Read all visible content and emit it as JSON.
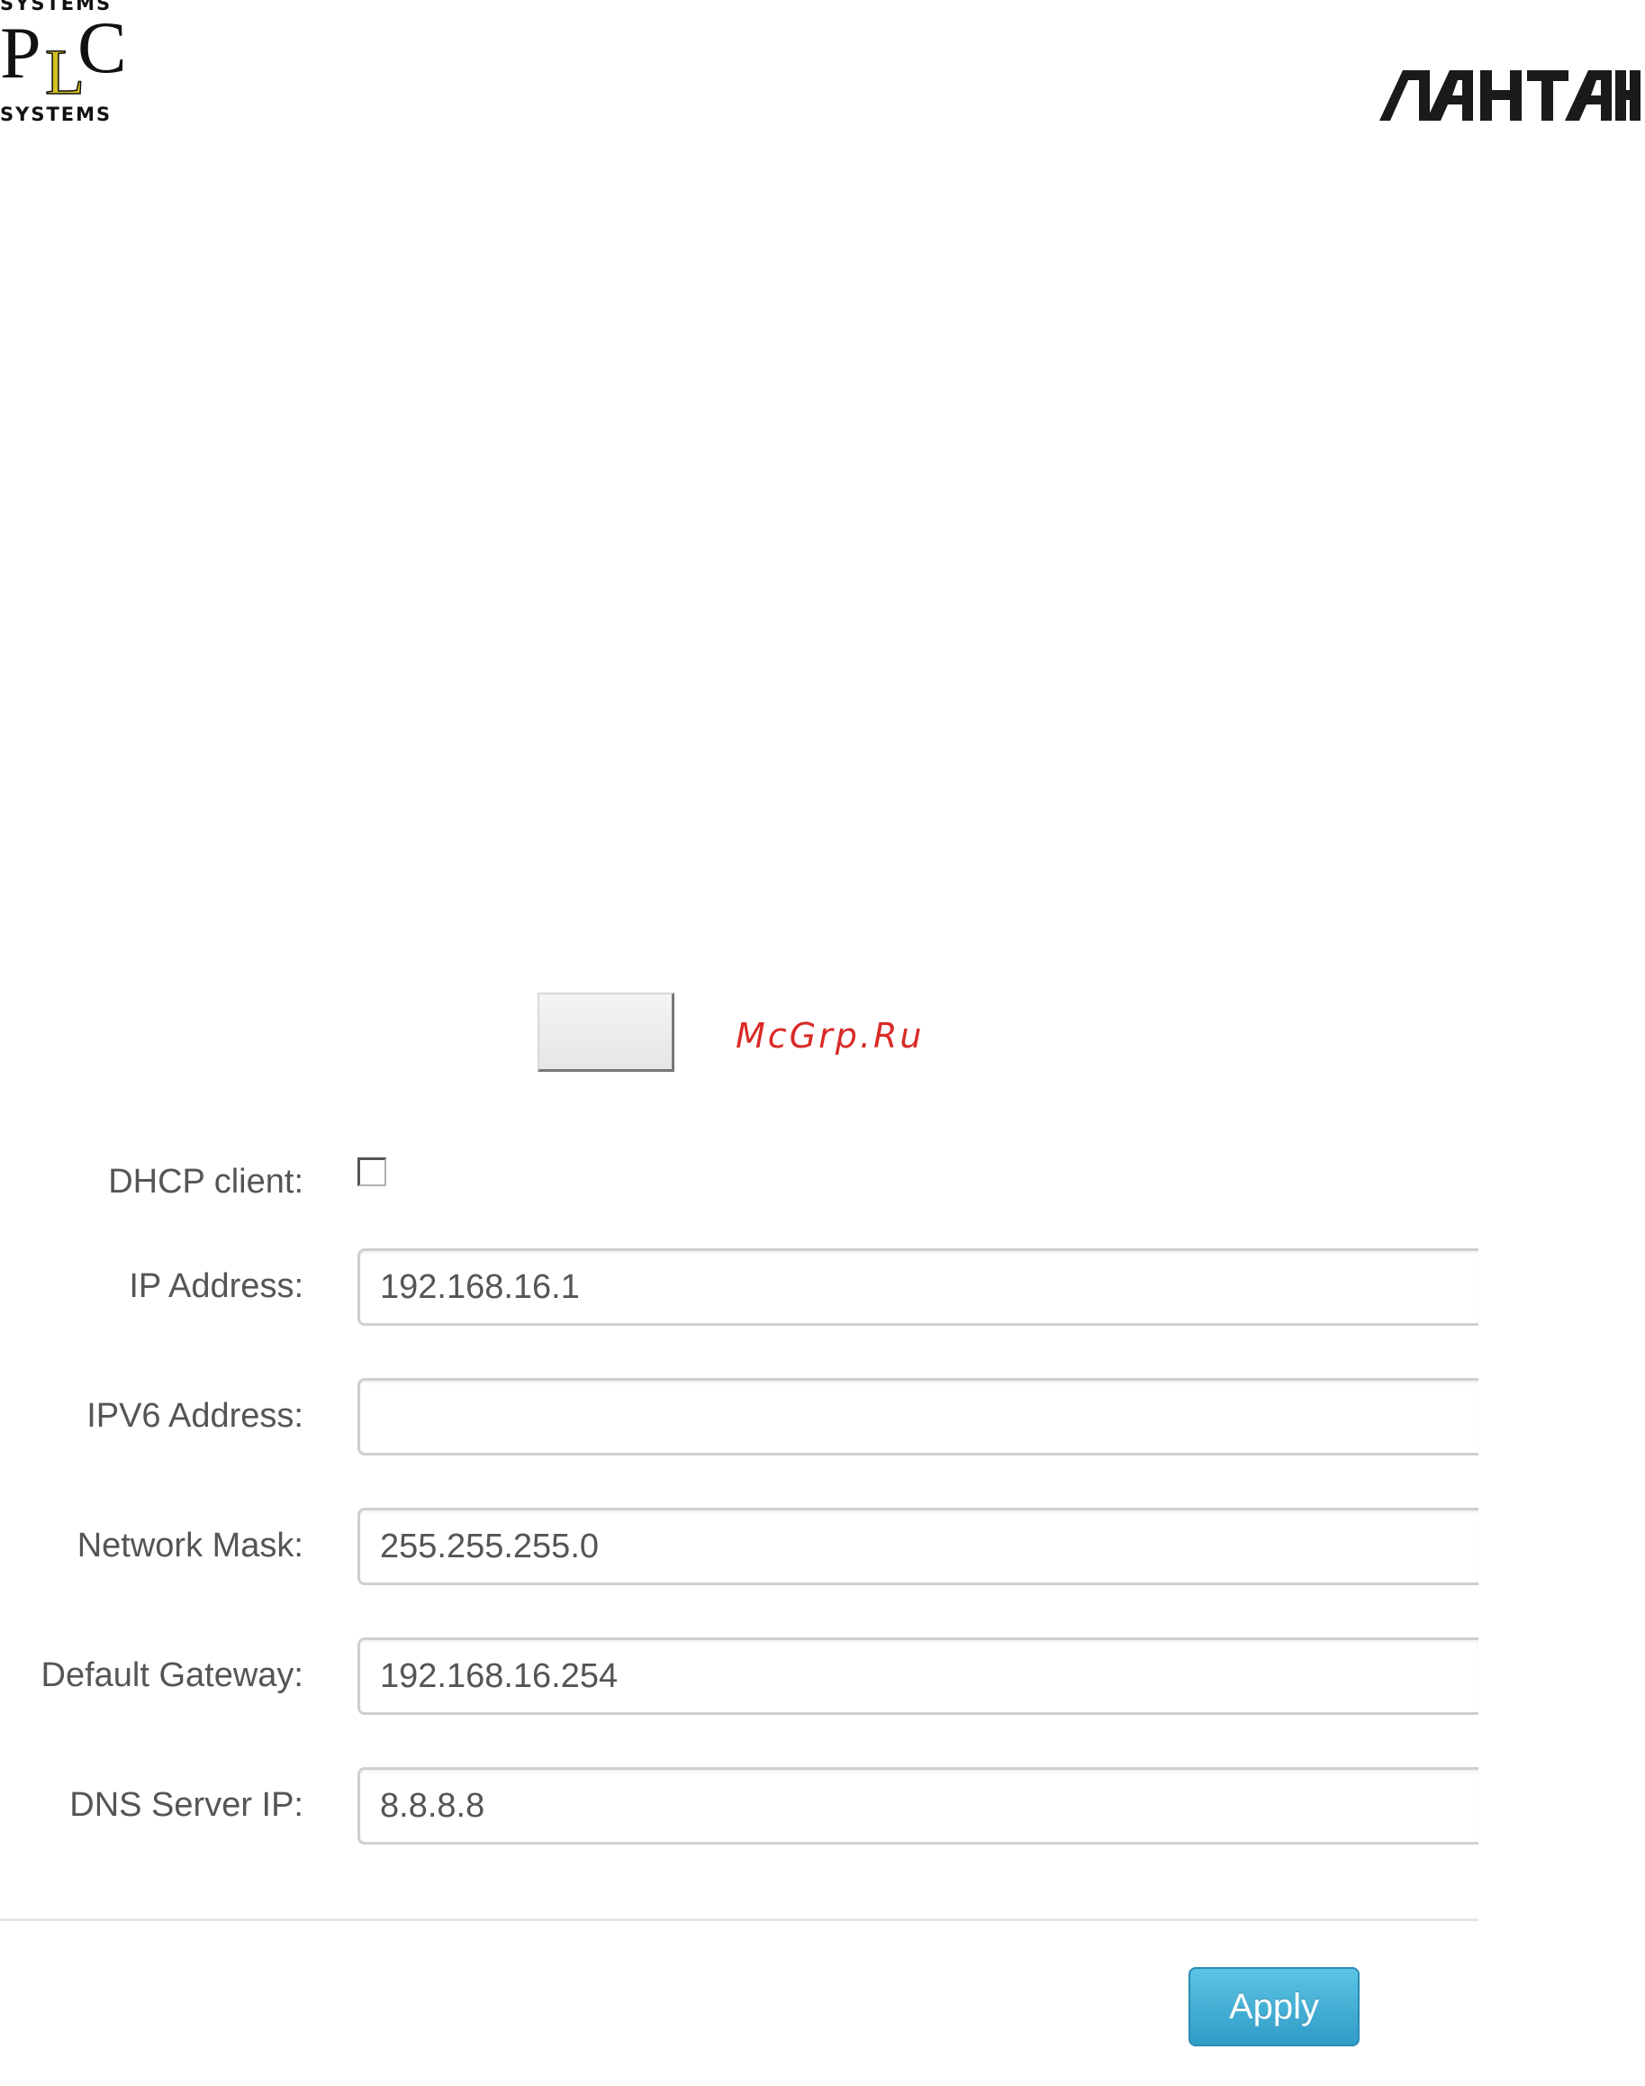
{
  "header": {
    "left_logo": {
      "top_word": "SYSTEMS",
      "letter_p": "P",
      "letter_l": "L",
      "letter_c": "C",
      "bottom_word": "SYSTEMS"
    },
    "right_logo": {
      "text": "ЛАНТАН"
    }
  },
  "toolbar": {
    "plain_button_label": "",
    "link_text": "McGrp.Ru"
  },
  "network_form": {
    "dhcp": {
      "label": "DHCP client:",
      "checked": false
    },
    "ip_address": {
      "label": "IP Address:",
      "value": "192.168.16.1"
    },
    "ipv6_address": {
      "label": "IPV6 Address:",
      "value": ""
    },
    "network_mask": {
      "label": "Network Mask:",
      "value": "255.255.255.0"
    },
    "default_gateway": {
      "label": "Default Gateway:",
      "value": "192.168.16.254"
    },
    "dns_server_ip": {
      "label": "DNS Server IP:",
      "value": "8.8.8.8"
    },
    "apply_label": "Apply"
  },
  "colors": {
    "label_text": "#555555",
    "link": "#d92b27",
    "apply_button": "#3aa7d1",
    "logo_accent": "#d4c020"
  }
}
